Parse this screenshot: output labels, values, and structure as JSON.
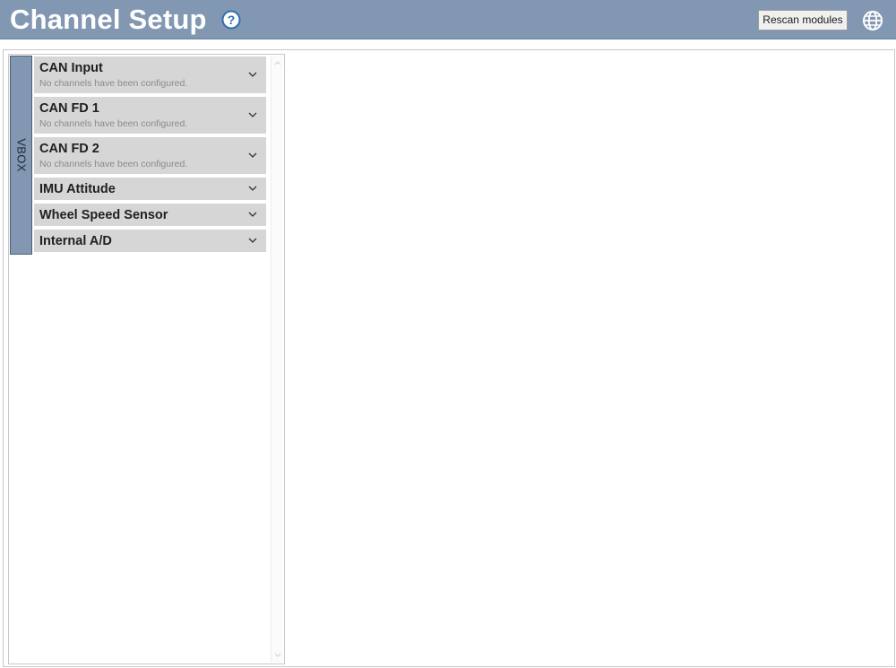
{
  "header": {
    "title": "Channel Setup",
    "help_icon": "question-circle-icon",
    "rescan_label": "Rescan modules",
    "globe_icon": "globe-icon"
  },
  "sidebar": {
    "tab_label": "VBOX",
    "items": [
      {
        "label": "CAN Input",
        "subtitle": "No channels have been configured."
      },
      {
        "label": "CAN FD 1",
        "subtitle": "No channels have been configured."
      },
      {
        "label": "CAN FD 2",
        "subtitle": "No channels have been configured."
      },
      {
        "label": "IMU Attitude"
      },
      {
        "label": "Wheel Speed Sensor"
      },
      {
        "label": "Internal A/D"
      }
    ]
  },
  "colors": {
    "header_bg": "#8197b2",
    "item_bg": "#d6d6d6",
    "tab_bg": "#8197b2",
    "help_blue": "#2f6fb0"
  }
}
